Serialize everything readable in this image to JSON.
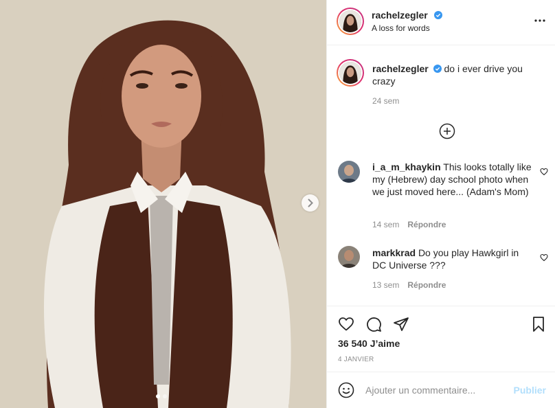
{
  "post": {
    "image_alt": "Portrait photo"
  },
  "header": {
    "username": "rachelzegler",
    "subtitle": "A loss for words",
    "more_icon": "more-horizontal-icon"
  },
  "caption": {
    "username": "rachelzegler",
    "text": "do i ever drive you crazy",
    "time": "24 sem"
  },
  "load_more_icon": "plus-circle-icon",
  "comments": [
    {
      "username": "i_a_m_khaykin",
      "text": "This looks totally like my (Hebrew) day school photo when we just moved here... (Adam's Mom)",
      "time": "14 sem",
      "reply_label": "Répondre"
    },
    {
      "username": "markkrad",
      "text": "Do you play Hawkgirl in DC Universe ???",
      "time": "13 sem",
      "reply_label": "Répondre"
    }
  ],
  "actions": {
    "likes": "36 540 J’aime",
    "date": "4 JANVIER"
  },
  "add_comment": {
    "placeholder": "Ajouter un commentaire...",
    "publish_label": "Publier"
  },
  "colors": {
    "verified": "#3897f0",
    "publish_disabled": "#b2dffc",
    "secondary_text": "#8e8e8e"
  }
}
